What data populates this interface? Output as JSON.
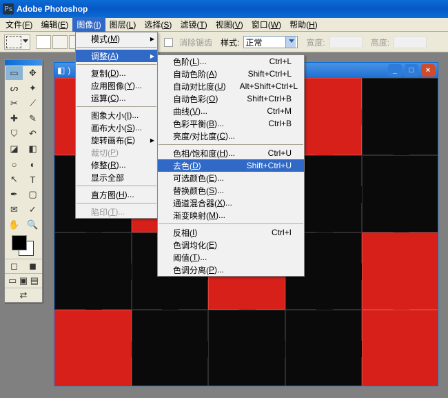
{
  "titlebar": {
    "icon_text": "Ps",
    "title": "Adobe Photoshop"
  },
  "menubar": {
    "items": [
      {
        "label": "文件",
        "key": "F"
      },
      {
        "label": "编辑",
        "key": "E"
      },
      {
        "label": "图像",
        "key": "I"
      },
      {
        "label": "图层",
        "key": "L"
      },
      {
        "label": "选择",
        "key": "S"
      },
      {
        "label": "滤镜",
        "key": "T"
      },
      {
        "label": "视图",
        "key": "V"
      },
      {
        "label": "窗口",
        "key": "W"
      },
      {
        "label": "帮助",
        "key": "H"
      }
    ],
    "active_index": 2
  },
  "optionsbar": {
    "antialias_label": "消除锯齿",
    "style_label": "样式:",
    "style_value": "正常",
    "width_label": "宽度:",
    "height_label": "高度:"
  },
  "menu1": {
    "items": [
      {
        "label": "模式",
        "key": "M",
        "arrow": true
      },
      null,
      {
        "label": "调整",
        "key": "A",
        "arrow": true,
        "highlight": true
      },
      null,
      {
        "label": "复制",
        "key": "D",
        "dots": true
      },
      {
        "label": "应用图像",
        "key": "Y",
        "dots": true
      },
      {
        "label": "运算",
        "key": "C",
        "dots": true
      },
      null,
      {
        "label": "图象大小",
        "key": "I",
        "dots": true
      },
      {
        "label": "画布大小",
        "key": "S",
        "dots": true
      },
      {
        "label": "旋转画布",
        "key": "E",
        "arrow": true
      },
      {
        "label": "裁切",
        "key": "P",
        "disabled": true
      },
      {
        "label": "修整",
        "key": "R",
        "dots": true
      },
      {
        "label": "显示全部",
        "key": ""
      },
      null,
      {
        "label": "直方图",
        "key": "H",
        "dots": true
      },
      null,
      {
        "label": "陷印",
        "key": "T",
        "dots": true,
        "disabled": true
      }
    ]
  },
  "menu2": {
    "items": [
      {
        "label": "色阶",
        "key": "L",
        "dots": true,
        "shortcut": "Ctrl+L"
      },
      {
        "label": "自动色阶",
        "key": "A",
        "shortcut": "Shift+Ctrl+L"
      },
      {
        "label": "自动对比度",
        "key": "U",
        "shortcut": "Alt+Shift+Ctrl+L"
      },
      {
        "label": "自动色彩",
        "key": "O",
        "shortcut": "Shift+Ctrl+B"
      },
      {
        "label": "曲线",
        "key": "V",
        "dots": true,
        "shortcut": "Ctrl+M"
      },
      {
        "label": "色彩平衡",
        "key": "B",
        "dots": true,
        "shortcut": "Ctrl+B"
      },
      {
        "label": "亮度/对比度",
        "key": "C",
        "dots": true
      },
      null,
      {
        "label": "色相/饱和度",
        "key": "H",
        "dots": true,
        "shortcut": "Ctrl+U"
      },
      {
        "label": "去色",
        "key": "D",
        "shortcut": "Shift+Ctrl+U",
        "highlight": true
      },
      {
        "label": "可选颜色",
        "key": "E",
        "dots": true
      },
      {
        "label": "替换颜色",
        "key": "S",
        "dots": true
      },
      {
        "label": "通道混合器",
        "key": "X",
        "dots": true
      },
      {
        "label": "渐变映射",
        "key": "M",
        "dots": true
      },
      null,
      {
        "label": "反相",
        "key": "I",
        "shortcut": "Ctrl+I"
      },
      {
        "label": "色调均化",
        "key": "E"
      },
      {
        "label": "阈值",
        "key": "T",
        "dots": true
      },
      {
        "label": "色调分离",
        "key": "P",
        "dots": true
      }
    ]
  },
  "docwin": {
    "title_suffix": ")"
  },
  "puzzle": {
    "colors": [
      [
        "red",
        "black",
        "black",
        "red",
        "black"
      ],
      [
        "black",
        "red",
        "red",
        "black",
        "black"
      ],
      [
        "black",
        "black",
        "red",
        "black",
        "red"
      ],
      [
        "red",
        "black",
        "black",
        "black",
        "red"
      ]
    ]
  }
}
